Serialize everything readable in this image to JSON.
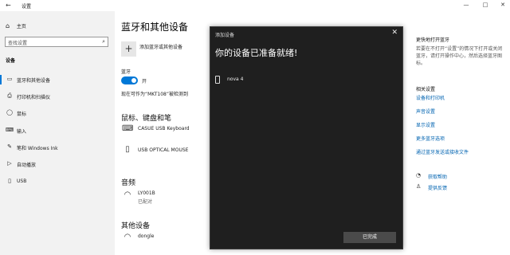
{
  "window": {
    "title": "设置",
    "back_icon": "←",
    "minimize": "—",
    "maximize": "□",
    "close": "✕"
  },
  "sidebar": {
    "home_label": "主页",
    "search_placeholder": "查找设置",
    "section_label": "设备",
    "items": [
      {
        "label": "蓝牙和其他设备",
        "icon": "▭"
      },
      {
        "label": "打印机和扫描仪",
        "icon": "⎙"
      },
      {
        "label": "鼠标",
        "icon": "◯"
      },
      {
        "label": "输入",
        "icon": "⌨"
      },
      {
        "label": "笔和 Windows Ink",
        "icon": "✎"
      },
      {
        "label": "自动播放",
        "icon": "▷"
      },
      {
        "label": "USB",
        "icon": "▯"
      }
    ]
  },
  "main": {
    "title": "蓝牙和其他设备",
    "add_label": "添加蓝牙或其他设备",
    "bluetooth_label": "蓝牙",
    "toggle_state": "开",
    "discoverable": "现在可作为“MKT108”被检测到",
    "mouse_section": "鼠标、键盘和笔",
    "mouse_devices": [
      {
        "name": "CASUE USB Keyboard"
      },
      {
        "name": "USB OPTICAL MOUSE"
      }
    ],
    "audio_section": "音频",
    "audio_device": {
      "name": "LY001B",
      "status": "已配对"
    },
    "other_section": "其他设备",
    "other_device": {
      "name": "dongle"
    }
  },
  "right": {
    "faster_title": "更快地打开蓝牙",
    "faster_text": "若要在不打开“设置”的情况下打开或关闭蓝牙，请打开操作中心，然后选择蓝牙图标。",
    "related_title": "相关设置",
    "links": [
      "设备和打印机",
      "声音设置",
      "显示设置",
      "更多蓝牙选项",
      "通过蓝牙发送或接收文件"
    ],
    "help_label": "获取帮助",
    "feedback_label": "提供反馈"
  },
  "dialog": {
    "title": "添加设备",
    "close": "✕",
    "heading": "你的设备已准备就绪!",
    "device_name": "nova 4",
    "done_label": "已完成"
  }
}
